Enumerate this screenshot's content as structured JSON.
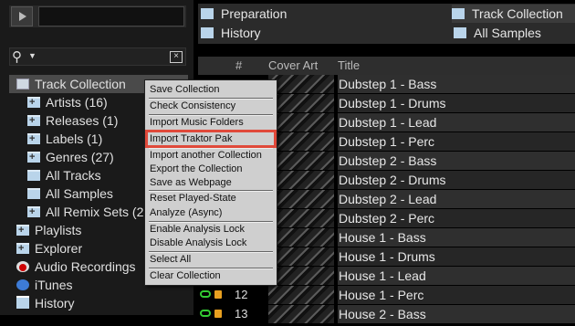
{
  "browser": {
    "tree": [
      {
        "name": "track-collection",
        "label": "Track Collection"
      },
      {
        "name": "artists",
        "label": "Artists (16)"
      },
      {
        "name": "releases",
        "label": "Releases (1)"
      },
      {
        "name": "labels",
        "label": "Labels (1)"
      },
      {
        "name": "genres",
        "label": "Genres (27)"
      },
      {
        "name": "all-tracks",
        "label": "All Tracks"
      },
      {
        "name": "all-samples",
        "label": "All Samples"
      },
      {
        "name": "all-remix-sets",
        "label": "All Remix Sets (2"
      },
      {
        "name": "playlists",
        "label": "Playlists"
      },
      {
        "name": "explorer",
        "label": "Explorer"
      },
      {
        "name": "audio-recordings",
        "label": "Audio Recordings"
      },
      {
        "name": "itunes",
        "label": "iTunes"
      },
      {
        "name": "history",
        "label": "History"
      }
    ]
  },
  "favorites": {
    "preparation": "Preparation",
    "track_collection": "Track Collection",
    "history": "History",
    "all_samples": "All Samples"
  },
  "table": {
    "headers": {
      "num": "#",
      "cover": "Cover Art",
      "title": "Title"
    },
    "rows": [
      {
        "num": "",
        "title": "Dubstep 1 - Bass"
      },
      {
        "num": "",
        "title": "Dubstep 1 - Drums"
      },
      {
        "num": "",
        "title": "Dubstep 1 - Lead"
      },
      {
        "num": "",
        "title": "Dubstep 1 - Perc"
      },
      {
        "num": "",
        "title": "Dubstep 2 - Bass"
      },
      {
        "num": "",
        "title": "Dubstep 2 - Drums"
      },
      {
        "num": "",
        "title": "Dubstep 2 - Lead"
      },
      {
        "num": "",
        "title": "Dubstep 2 - Perc"
      },
      {
        "num": "",
        "title": "House 1 - Bass"
      },
      {
        "num": "",
        "title": "House 1 - Drums"
      },
      {
        "num": "",
        "title": "House 1 - Lead"
      },
      {
        "num": "12",
        "title": "House 1 - Perc"
      },
      {
        "num": "13",
        "title": "House 2 - Bass"
      }
    ]
  },
  "context_menu": {
    "items": [
      "Save Collection",
      "Check Consistency",
      "Import Music Folders",
      "Import Traktor Pak",
      "Import another Collection",
      "Export the Collection",
      "Save as Webpage",
      "Reset Played-State",
      "Analyze (Async)",
      "Enable Analysis Lock",
      "Disable Analysis Lock",
      "Select All",
      "Clear Collection"
    ],
    "highlighted_item": "Import Traktor Pak",
    "highlight_color": "#e0493a"
  },
  "search": {
    "value": ""
  }
}
